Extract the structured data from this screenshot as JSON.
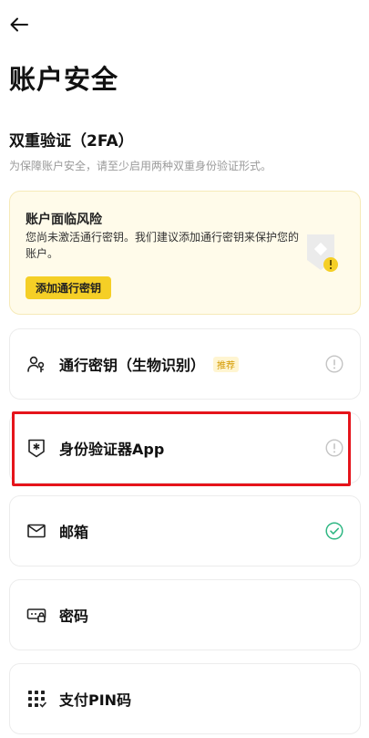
{
  "page": {
    "title": "账户安全"
  },
  "twofa": {
    "title": "双重验证（2FA）",
    "description": "为保障账户安全，请至少启用两种双重身份验证形式。"
  },
  "risk_card": {
    "title": "账户面临风险",
    "description": "您尚未激活通行密钥。我们建议添加通行密钥来保护您的账户。",
    "button_label": "添加通行密钥"
  },
  "methods": [
    {
      "label": "通行密钥（生物识别）",
      "badge": "推荐",
      "icon": "passkey-users-icon",
      "status": "warning"
    },
    {
      "label": "身份验证器App",
      "badge": "",
      "icon": "authenticator-shield-icon",
      "status": "warning"
    },
    {
      "label": "邮箱",
      "badge": "",
      "icon": "mail-icon",
      "status": "enabled"
    },
    {
      "label": "密码",
      "badge": "",
      "icon": "password-icon",
      "status": "none"
    },
    {
      "label": "支付PIN码",
      "badge": "",
      "icon": "pin-keypad-icon",
      "status": "none"
    }
  ],
  "colors": {
    "accent": "#f5cf26",
    "success": "#2fb783",
    "highlight": "#e5141b",
    "warning_bg": "#fffbea"
  }
}
